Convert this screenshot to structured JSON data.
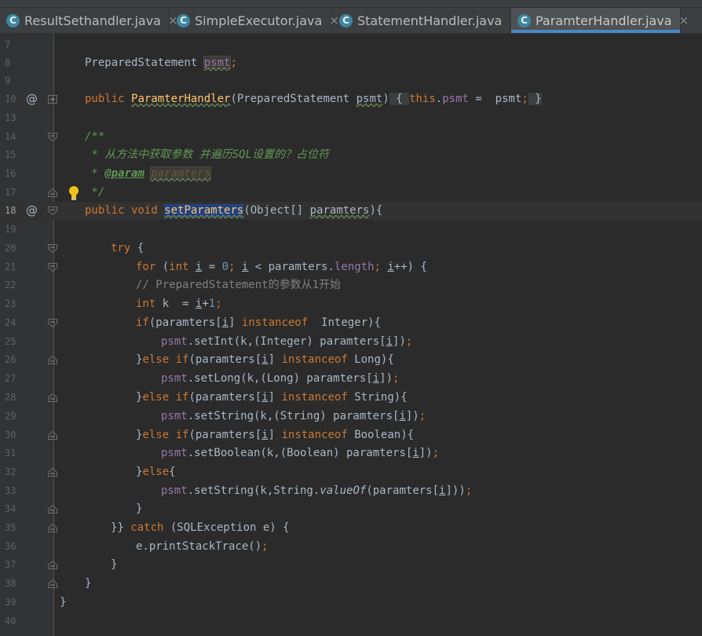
{
  "tabs": [
    {
      "icon": "C",
      "label": "ResultSethandler.java",
      "active": false
    },
    {
      "icon": "C",
      "label": "SimpleExecutor.java",
      "active": false
    },
    {
      "icon": "C",
      "label": "StatementHandler.java",
      "active": false
    },
    {
      "icon": "C",
      "label": "ParamterHandler.java",
      "active": true
    }
  ],
  "tab_close_glyph": "×",
  "colors": {
    "background": "#2b2b2b",
    "keyword": "#cc7832",
    "doc_comment": "#629755",
    "line_comment": "#808080",
    "number": "#6897bb",
    "field": "#9876aa",
    "method": "#ffc66d",
    "active_tab_underline": "#4a88c7"
  },
  "gutter": {
    "line_numbers": [
      "7",
      "8",
      "9",
      "10",
      "13",
      "14",
      "15",
      "16",
      "17",
      "18",
      "19",
      "20",
      "21",
      "22",
      "23",
      "24",
      "25",
      "26",
      "27",
      "28",
      "29",
      "30",
      "31",
      "32",
      "33",
      "34",
      "35",
      "36",
      "37",
      "38",
      "39",
      "40"
    ],
    "override_marker": "@",
    "current_line": "18",
    "icons": [
      "fold-icon",
      "intention-bulb-icon",
      "override-icon"
    ]
  },
  "code": {
    "l8": {
      "t1": "PreparedStatement ",
      "t2": "psmt",
      "t3": ";"
    },
    "l10": {
      "t1": "public ",
      "t2": "ParamterHandler",
      "t3": "(PreparedStatement ",
      "t4": "psmt",
      "t5": ")",
      "t6": " { ",
      "t7": "this",
      "t8": ".",
      "t9": "psmt",
      "t10": " =  psmt",
      "t11": ";",
      "t12": " }"
    },
    "l14": "/**",
    "l15": " * 从方法中获取参数 并遍历SQL设置的？占位符",
    "l16": {
      "t1": " * ",
      "t2": "@param",
      "t3": " ",
      "t4": "paramters"
    },
    "l17": " */",
    "l18": {
      "t1": "public void ",
      "t2": "setParamters",
      "t3": "(Object[] ",
      "t4": "paramters",
      "t5": "){"
    },
    "l20": {
      "t1": "try",
      "t2": " {"
    },
    "l21": {
      "t1": "for ",
      "t2": "(",
      "t3": "int ",
      "t4": "i",
      "t5": " = ",
      "t6": "0",
      "t7": "; ",
      "t8": "i",
      "t9": " < paramters.",
      "t10": "length",
      "t11": "; ",
      "t12": "i",
      "t13": "++) {"
    },
    "l22": "// PreparedStatement的参数从1开始",
    "l23": {
      "t1": "int ",
      "t2": "k  = ",
      "t3": "i",
      "t4": "+",
      "t5": "1",
      "t6": ";"
    },
    "l24": {
      "t1": "if",
      "t2": "(paramters[",
      "t3": "i",
      "t4": "] ",
      "t5": "instanceof  ",
      "t6": "Integer){"
    },
    "l25": {
      "t1": "psmt",
      "t2": ".setInt(k,(Integer) paramters[",
      "t3": "i",
      "t4": "])",
      "t5": ";"
    },
    "l26": {
      "t1": "}",
      "t2": "else if",
      "t3": "(paramters[",
      "t4": "i",
      "t5": "] ",
      "t6": "instanceof ",
      "t7": "Long){"
    },
    "l27": {
      "t1": "psmt",
      "t2": ".setLong(k,(Long) paramters[",
      "t3": "i",
      "t4": "])",
      "t5": ";"
    },
    "l28": {
      "t1": "}",
      "t2": "else if",
      "t3": "(paramters[",
      "t4": "i",
      "t5": "] ",
      "t6": "instanceof ",
      "t7": "String){"
    },
    "l29": {
      "t1": "psmt",
      "t2": ".setString(k,(String) paramters[",
      "t3": "i",
      "t4": "])",
      "t5": ";"
    },
    "l30": {
      "t1": "}",
      "t2": "else if",
      "t3": "(paramters[",
      "t4": "i",
      "t5": "] ",
      "t6": "instanceof ",
      "t7": "Boolean){"
    },
    "l31": {
      "t1": "psmt",
      "t2": ".setBoolean(k,(Boolean) paramters[",
      "t3": "i",
      "t4": "])",
      "t5": ";"
    },
    "l32": {
      "t1": "}",
      "t2": "else",
      "t3": "{"
    },
    "l33": {
      "t1": "psmt",
      "t2": ".setString(k,String.",
      "t3": "valueOf",
      "t4": "(paramters[",
      "t5": "i",
      "t6": "]))",
      "t7": ";"
    },
    "l34": "}",
    "l35": {
      "t1": "}} ",
      "t2": "catch ",
      "t3": "(SQLException e) {"
    },
    "l36": {
      "t1": "e.printStackTrace()",
      "t2": ";"
    },
    "l37": "}",
    "l38": "}",
    "l39": "}"
  }
}
